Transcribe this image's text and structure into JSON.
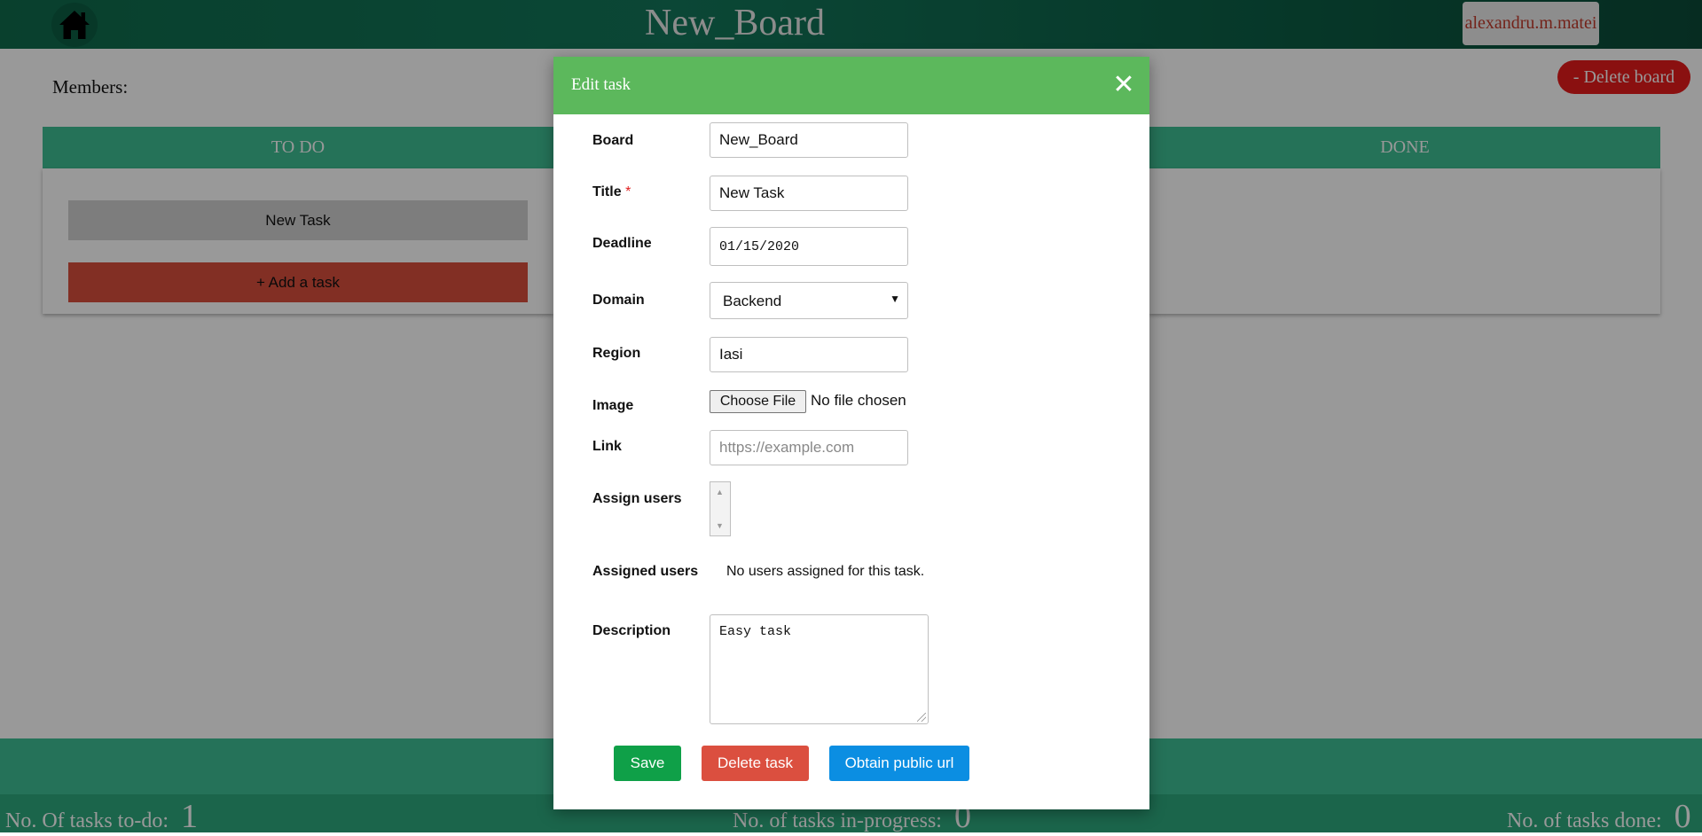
{
  "header": {
    "board_title": "New_Board",
    "user_name": "alexandru.m.matei",
    "home_icon": "home-icon"
  },
  "board": {
    "members_label": "Members:",
    "delete_board_label": "- Delete board",
    "columns": [
      {
        "title": "TO DO"
      },
      {
        "title": "DONE"
      }
    ],
    "tasks": [
      {
        "title": "New Task"
      }
    ],
    "add_task_label": "+ Add a task"
  },
  "footer": {
    "todo_label": "No. Of tasks to-do:",
    "todo_count": "1",
    "inprogress_label": "No. of tasks in-progress:",
    "inprogress_count": "0",
    "done_label": "No. of tasks done:",
    "done_count": "0"
  },
  "modal": {
    "title": "Edit task",
    "close_symbol": "✕",
    "fields": {
      "board_label": "Board",
      "board_value": "New_Board",
      "title_label": "Title",
      "title_required_mark": "*",
      "title_value": "New Task",
      "deadline_label": "Deadline",
      "deadline_value": "01/15/2020",
      "domain_label": "Domain",
      "domain_value": "Backend",
      "region_label": "Region",
      "region_value": "Iasi",
      "image_label": "Image",
      "image_button": "Choose File",
      "image_status": "No file chosen",
      "link_label": "Link",
      "link_placeholder": "https://example.com",
      "assign_users_label": "Assign users",
      "assigned_users_label": "Assigned users",
      "assigned_users_text": "No users assigned for this task.",
      "description_label": "Description",
      "description_value": "Easy task"
    },
    "buttons": {
      "save": "Save",
      "delete": "Delete task",
      "public_url": "Obtain public url"
    }
  },
  "colors": {
    "header_green": "#13775a",
    "column_header": "#3ebe93",
    "modal_header": "#5cb85c",
    "save": "#0fa048",
    "delete": "#db4f3f",
    "public_url": "#0b8ee2",
    "delete_board": "#e61b1b",
    "add_task": "#d94f3d"
  }
}
